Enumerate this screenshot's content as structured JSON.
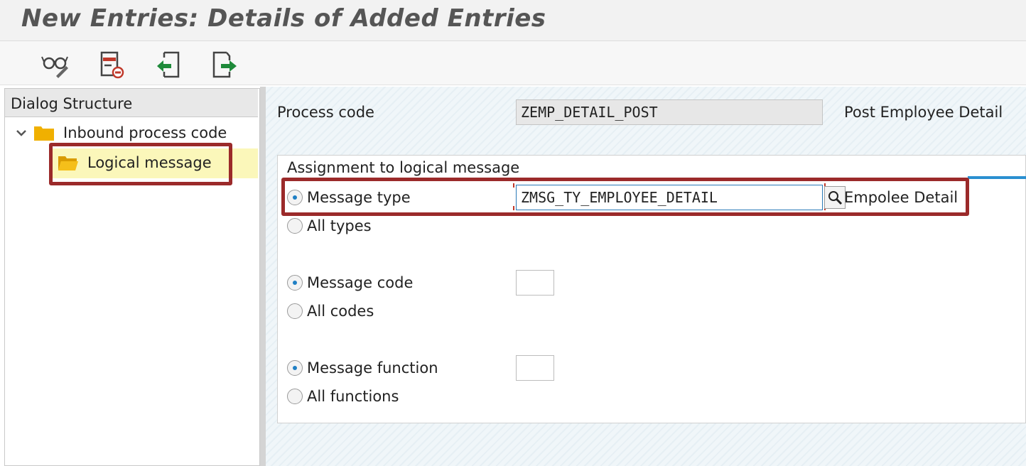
{
  "window": {
    "title": "New Entries: Details of Added Entries"
  },
  "toolbar": {
    "buttons": [
      {
        "name": "display-change-icon"
      },
      {
        "name": "delete-icon"
      },
      {
        "name": "previous-entry-icon"
      },
      {
        "name": "next-entry-icon"
      }
    ]
  },
  "dialog_structure": {
    "header": "Dialog Structure",
    "items": [
      {
        "label": "Inbound process code",
        "expanded": true
      },
      {
        "label": "Logical message",
        "selected": true
      }
    ]
  },
  "form": {
    "process_code": {
      "label": "Process code",
      "value": "ZEMP_DETAIL_POST",
      "description": "Post Employee Detail"
    },
    "assignment": {
      "title": "Assignment to logical message",
      "message_type": {
        "label": "Message type",
        "value": "ZMSG_TY_EMPLOYEE_DETAIL",
        "description": "Empolee Detail",
        "selected": true
      },
      "all_types": {
        "label": "All types",
        "selected": false
      },
      "message_code": {
        "label": "Message code",
        "value": "",
        "selected": true
      },
      "all_codes": {
        "label": "All codes",
        "selected": false
      },
      "message_function": {
        "label": "Message function",
        "value": "",
        "selected": true
      },
      "all_functions": {
        "label": "All functions",
        "selected": false
      }
    }
  },
  "colors": {
    "highlight_border": "#9b2a2a",
    "selection_bg": "#fbf7ba",
    "accent_blue": "#2a8fd0"
  }
}
